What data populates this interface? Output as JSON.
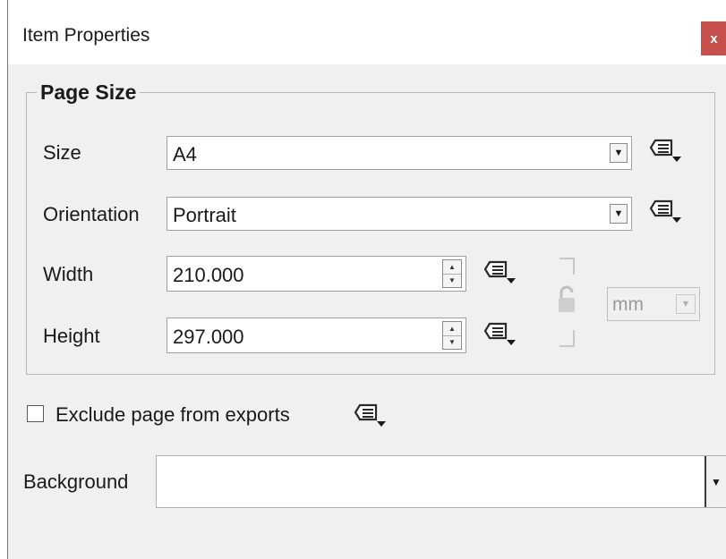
{
  "window": {
    "title": "Item Properties",
    "close_label": "x"
  },
  "page_size": {
    "group_title": "Page Size",
    "size": {
      "label": "Size",
      "value": "A4"
    },
    "orientation": {
      "label": "Orientation",
      "value": "Portrait"
    },
    "width": {
      "label": "Width",
      "value": "210.000"
    },
    "height": {
      "label": "Height",
      "value": "297.000"
    },
    "units": {
      "value": "mm",
      "enabled": false
    },
    "lock_aspect": {
      "locked": false,
      "enabled": false
    }
  },
  "exclude": {
    "label": "Exclude page from exports",
    "checked": false
  },
  "background": {
    "label": "Background",
    "value": ""
  },
  "icons": {
    "data_defined": "data-defined-override-icon",
    "lock": "lock-icon",
    "dropdown": "chevron-down-icon",
    "spin": "spin-arrows-icon"
  },
  "colors": {
    "close_button": "#c8504c",
    "window_bg": "#f0f0f0"
  }
}
